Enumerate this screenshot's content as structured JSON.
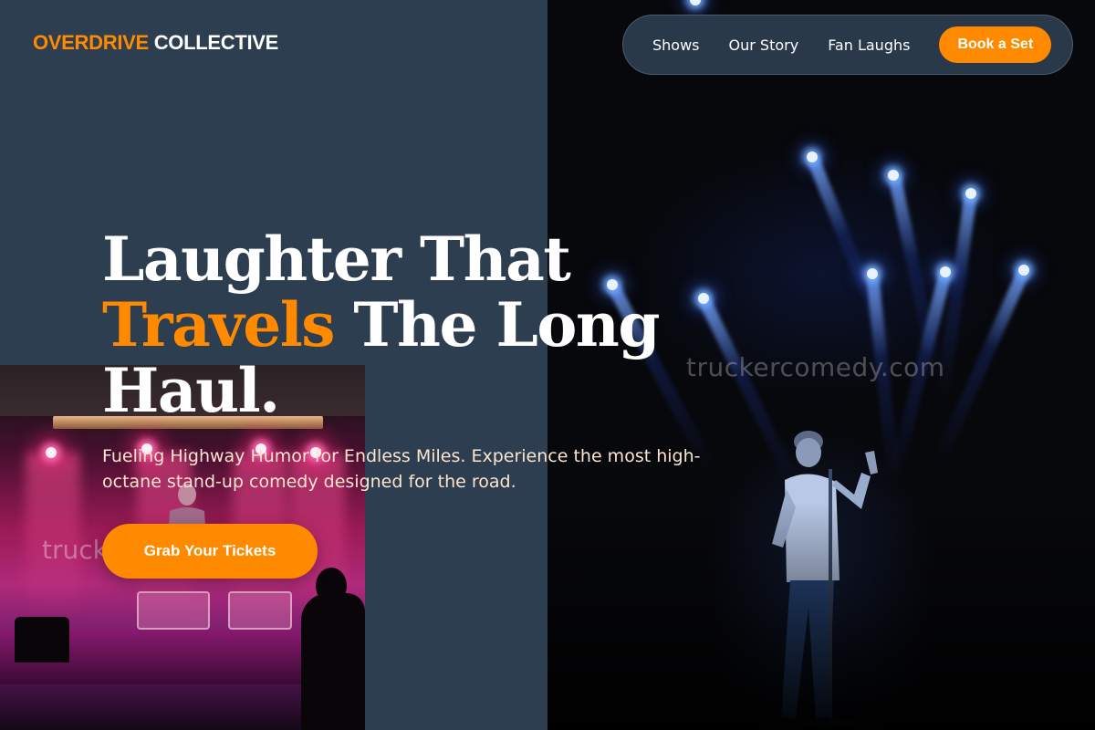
{
  "header": {
    "logo_accent": "OVERDRIVE",
    "logo_rest": " COLLECTIVE",
    "nav": {
      "links": [
        "Shows",
        "Our Story",
        "Fan Laughs"
      ],
      "cta": "Book a Set"
    }
  },
  "hero": {
    "headline_line1": "Laughter That",
    "headline_accent": "Travels",
    "headline_line2_rest": " The Long",
    "headline_line3": "Haul.",
    "subtext": "Fueling Highway Humor for Endless Miles. Experience the most high-octane stand-up comedy designed for the road.",
    "cta": "Grab Your Tickets"
  },
  "images": {
    "left_photo": {
      "watermark": "truckercomedy.com",
      "subject": "pink-lit comedy stage"
    },
    "right_photo": {
      "watermark": "truckercomedy.com",
      "subject": "comedian on blue-lit stage"
    }
  },
  "colors": {
    "accent": "#ff8a00",
    "background": "#2c3e50",
    "subtext": "#fde4cf"
  }
}
